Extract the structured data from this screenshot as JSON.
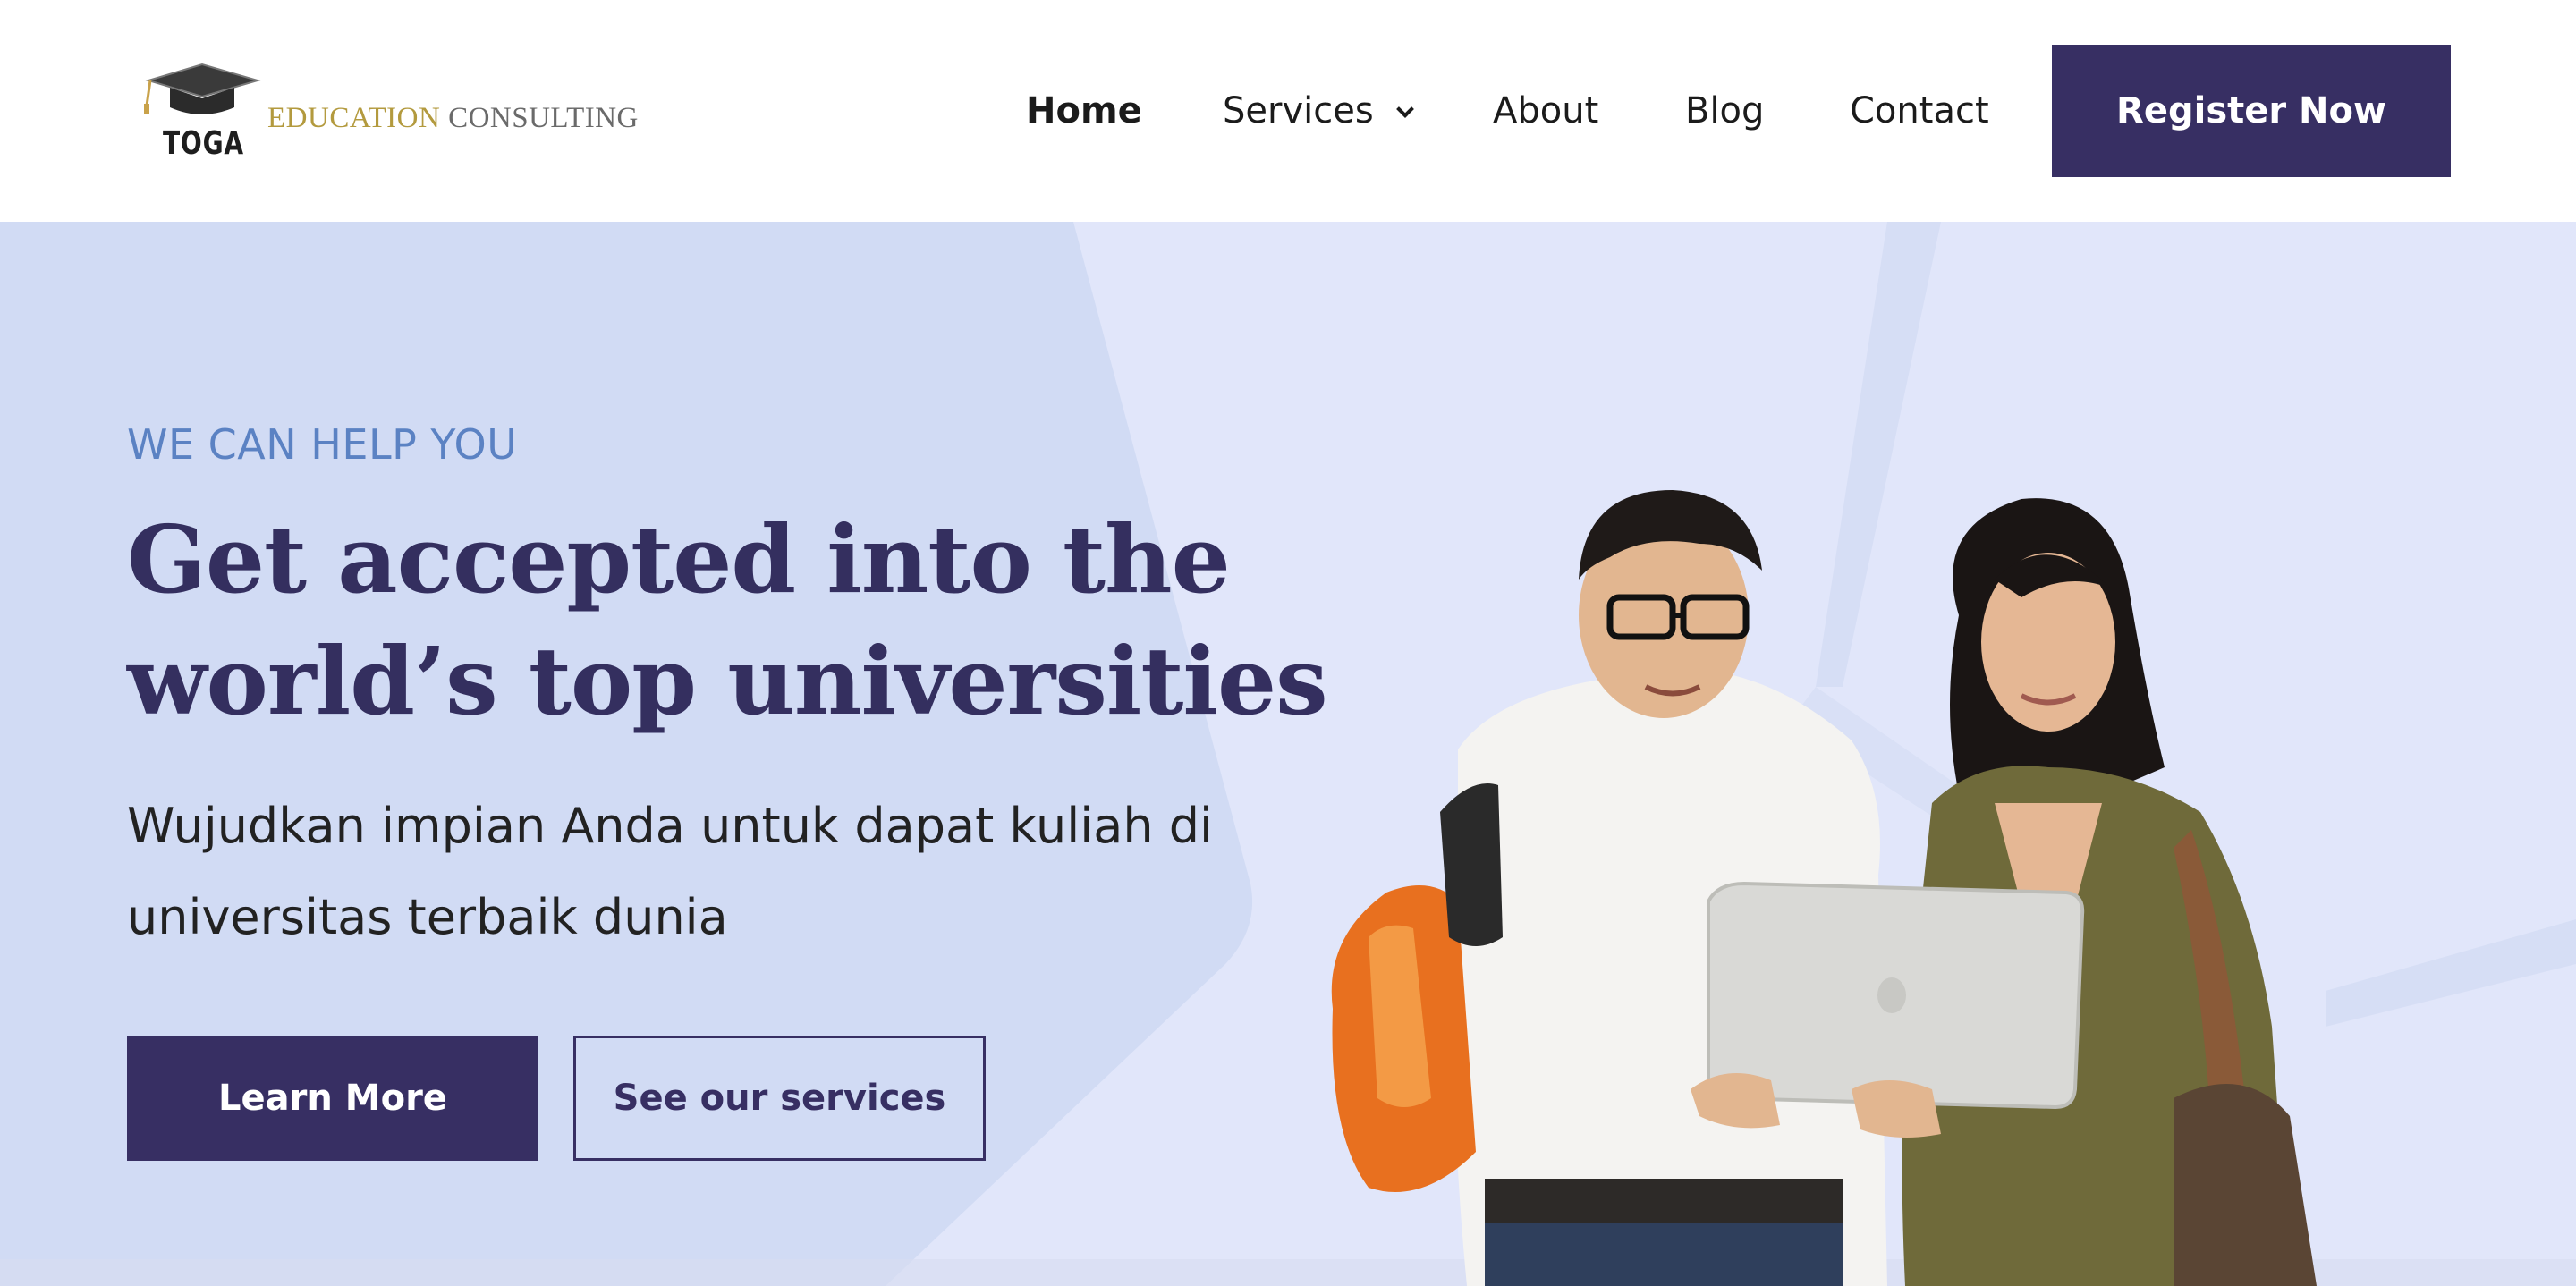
{
  "header": {
    "logo": {
      "mark_text": "TOGA",
      "text_part1": "EDUCATION",
      "text_part2": "CONSULTING",
      "colors": {
        "gold": "#b39a3e",
        "gray": "#6a6a6a"
      }
    },
    "nav": {
      "home": "Home",
      "services": "Services",
      "about": "About",
      "blog": "Blog",
      "contact": "Contact"
    },
    "cta_label": "Register Now"
  },
  "hero": {
    "eyebrow": "WE CAN HELP YOU",
    "headline_line1": "Get accepted into the",
    "headline_line2": "world’s top universities",
    "subtext_line1": "Wujudkan impian Anda untuk dapat kuliah di",
    "subtext_line2": "universitas terbaik dunia",
    "primary_button": "Learn More",
    "secondary_button": "See our services",
    "photo_description_icon": "students-with-laptop-photo"
  },
  "colors": {
    "brand": "#372f63",
    "accent_text": "#5b82c3",
    "hero_bg": "#e1e6fa",
    "hero_bg_panel": "#d1dbf4"
  }
}
